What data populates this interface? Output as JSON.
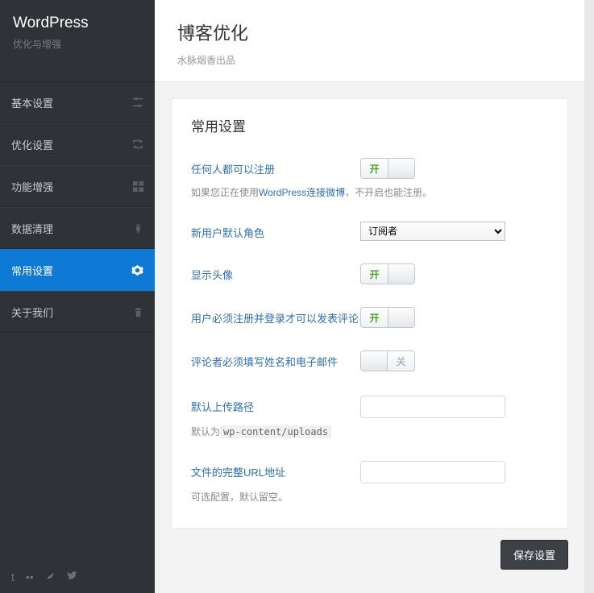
{
  "brand": {
    "title": "WordPress",
    "subtitle": "优化与增强"
  },
  "nav": {
    "items": [
      {
        "label": "基本设置",
        "icon": "sliders"
      },
      {
        "label": "优化设置",
        "icon": "loop"
      },
      {
        "label": "功能增强",
        "icon": "grid"
      },
      {
        "label": "数据清理",
        "icon": "plug"
      },
      {
        "label": "常用设置",
        "icon": "gear",
        "active": true
      },
      {
        "label": "关于我们",
        "icon": "trash"
      }
    ]
  },
  "page": {
    "title": "博客优化",
    "subtitle": "水脉烟香出品"
  },
  "panel": {
    "title": "常用设置"
  },
  "toggle_labels": {
    "on": "开",
    "off": "关"
  },
  "settings": {
    "anyone_register": {
      "label": "任何人都可以注册",
      "state": "on",
      "help_prefix": "如果您正在使用",
      "help_link": "WordPress连接微博",
      "help_suffix": "，不开启也能注册。"
    },
    "default_role": {
      "label": "新用户默认角色",
      "value": "订阅者",
      "options": [
        "订阅者"
      ]
    },
    "show_avatar": {
      "label": "显示头像",
      "state": "on"
    },
    "must_register_to_comment": {
      "label": "用户必须注册并登录才可以发表评论",
      "state": "on"
    },
    "require_name_email": {
      "label": "评论者必须填写姓名和电子邮件",
      "state": "off"
    },
    "upload_path": {
      "label": "默认上传路径",
      "value": "",
      "help_prefix": "默认为",
      "help_code": "wp-content/uploads"
    },
    "upload_url": {
      "label": "文件的完整URL地址",
      "value": "",
      "help": "可选配置，默认留空。"
    }
  },
  "actions": {
    "save": "保存设置"
  }
}
